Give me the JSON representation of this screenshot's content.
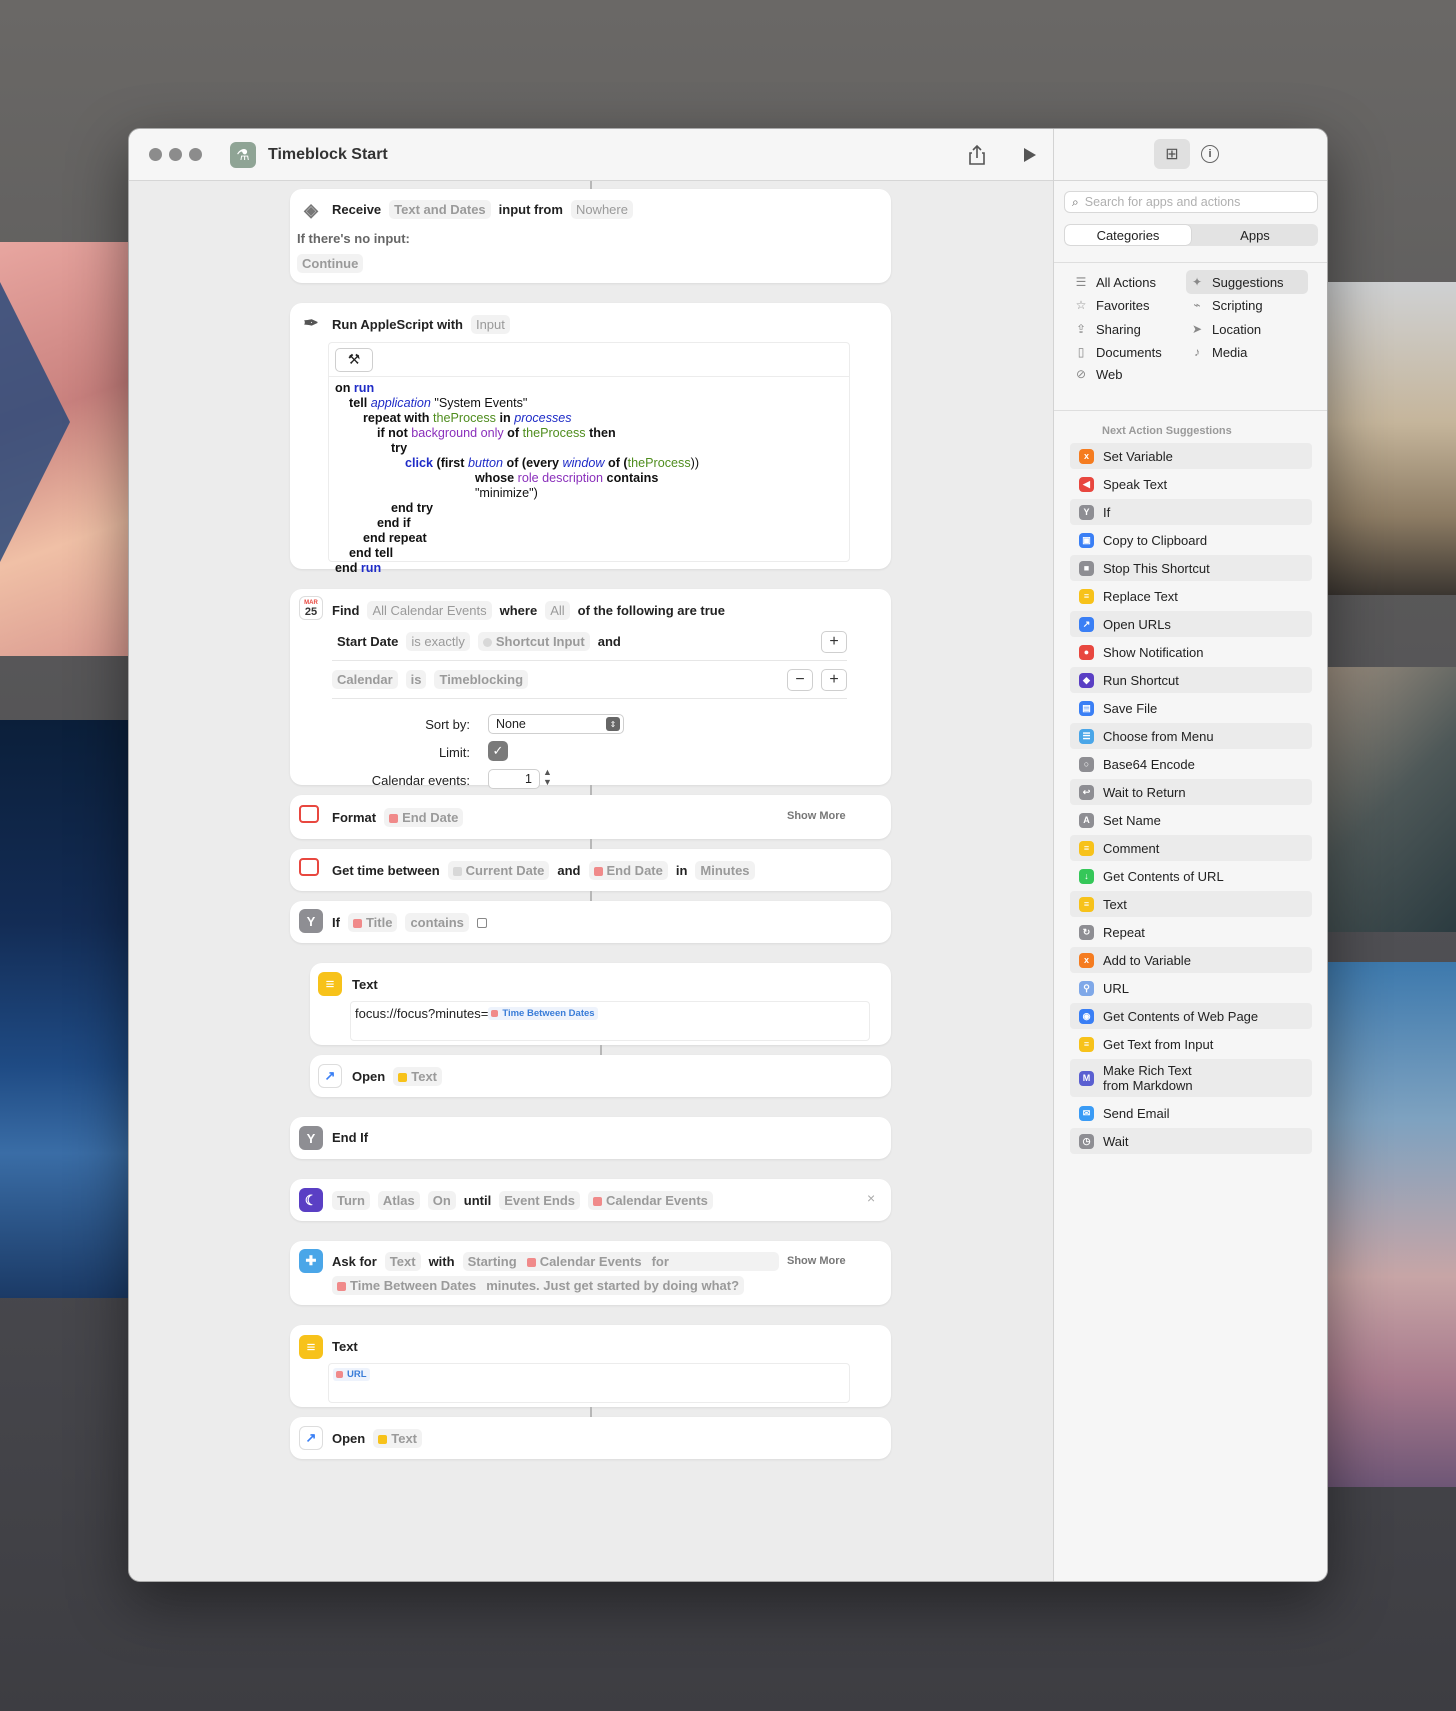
{
  "window": {
    "title": "Timeblock Start"
  },
  "actions": {
    "receive": {
      "verb": "Receive",
      "types": "Text and Dates",
      "mid": "input from",
      "source": "Nowhere",
      "noinput_label": "If there's no input:",
      "noinput_value": "Continue"
    },
    "applescript": {
      "title": "Run AppleScript with",
      "input": "Input",
      "lines": [
        [
          [
            "on ",
            "b"
          ],
          [
            "run",
            "b blue"
          ]
        ],
        [
          [
            "    tell ",
            "b"
          ],
          [
            "application",
            "it blue"
          ],
          [
            " \"System Events\"",
            ""
          ]
        ],
        [
          [
            "        repeat with ",
            "b"
          ],
          [
            "theProcess",
            "grn"
          ],
          [
            " in ",
            "b"
          ],
          [
            "processes",
            "it blue"
          ]
        ],
        [
          [
            "            if not ",
            "b"
          ],
          [
            "background only",
            "pur"
          ],
          [
            " of ",
            "b"
          ],
          [
            "theProcess",
            "grn"
          ],
          [
            " then",
            "b"
          ]
        ],
        [
          [
            "                try",
            "b"
          ]
        ],
        [
          [
            "                    ",
            "b"
          ],
          [
            "click",
            "b blue"
          ],
          [
            " (",
            "b"
          ],
          [
            "first ",
            "b"
          ],
          [
            "button",
            "it blue"
          ],
          [
            " of (",
            "b"
          ],
          [
            "every ",
            "b"
          ],
          [
            "window",
            "it blue"
          ],
          [
            " of (",
            "b"
          ],
          [
            "theProcess",
            "grn"
          ],
          [
            "))",
            ""
          ]
        ],
        [
          [
            "                                        whose ",
            "b"
          ],
          [
            "role description",
            "pur"
          ],
          [
            " contains",
            "b"
          ]
        ],
        [
          [
            "                                        \"minimize\")",
            ""
          ]
        ],
        [
          [
            "                end try",
            "b"
          ]
        ],
        [
          [
            "            end if",
            "b"
          ]
        ],
        [
          [
            "        end repeat",
            "b"
          ]
        ],
        [
          [
            "    end tell",
            "b"
          ]
        ],
        [
          [
            "end ",
            "b"
          ],
          [
            "run",
            "b blue"
          ]
        ]
      ]
    },
    "find": {
      "verb": "Find",
      "source": "All Calendar Events",
      "where": "where",
      "all": "All",
      "tail": "of the following are true",
      "filter1": {
        "field": "Start Date",
        "op": "is exactly",
        "value": "Shortcut Input",
        "conj": "and"
      },
      "filter2": {
        "field": "Calendar",
        "op": "is",
        "value": "Timeblocking"
      },
      "sort_label": "Sort by:",
      "sort_value": "None",
      "limit_label": "Limit:",
      "limit_checked": true,
      "events_label": "Calendar events:",
      "events_value": "1",
      "date_badge_top": "MAR",
      "date_badge_num": "25"
    },
    "format": {
      "verb": "Format",
      "value": "End Date",
      "show_more": "Show More"
    },
    "timebetween": {
      "verb": "Get time between",
      "a": "Current Date",
      "and": "and",
      "b": "End Date",
      "in": "in",
      "unit": "Minutes"
    },
    "if": {
      "verb": "If",
      "field": "Title",
      "op": "contains"
    },
    "text1": {
      "title": "Text",
      "prefix": "focus://focus?minutes=",
      "var": "Time Between Dates"
    },
    "open1": {
      "verb": "Open",
      "value": "Text"
    },
    "endif": {
      "label": "End If"
    },
    "focus": {
      "a": "Turn",
      "b": "Atlas",
      "c": "On",
      "until": "until",
      "d": "Event Ends",
      "e": "Calendar Events"
    },
    "ask": {
      "verb": "Ask for",
      "type": "Text",
      "with": "with",
      "a": "Starting",
      "b": "Calendar Events",
      "for": "for",
      "show_more": "Show More",
      "c": "Time Between Dates",
      "d": "minutes. Just get started by doing what?"
    },
    "text2": {
      "title": "Text",
      "var": "URL"
    },
    "open2": {
      "verb": "Open",
      "value": "Text"
    }
  },
  "sidebar": {
    "search_placeholder": "Search for apps and actions",
    "seg": [
      "Categories",
      "Apps"
    ],
    "categories": [
      {
        "label": "All Actions",
        "icon": "list-icon"
      },
      {
        "label": "Suggestions",
        "icon": "sparkle-icon"
      },
      {
        "label": "Favorites",
        "icon": "star-icon"
      },
      {
        "label": "Scripting",
        "icon": "scripting-icon"
      },
      {
        "label": "Sharing",
        "icon": "share-icon"
      },
      {
        "label": "Location",
        "icon": "location-icon"
      },
      {
        "label": "Documents",
        "icon": "document-icon"
      },
      {
        "label": "Media",
        "icon": "music-icon"
      },
      {
        "label": "Web",
        "icon": "compass-icon"
      }
    ],
    "suggestions_heading": "Next Action Suggestions",
    "suggestions": [
      {
        "label": "Set Variable",
        "color": "#f57c20",
        "glyph": "x"
      },
      {
        "label": "Speak Text",
        "color": "#e8473f",
        "glyph": "◀"
      },
      {
        "label": "If",
        "color": "#8e8e93",
        "glyph": "Y"
      },
      {
        "label": "Copy to Clipboard",
        "color": "#3a7ff5",
        "glyph": "▣"
      },
      {
        "label": "Stop This Shortcut",
        "color": "#8e8e93",
        "glyph": "■"
      },
      {
        "label": "Replace Text",
        "color": "#f7c21a",
        "glyph": "≡"
      },
      {
        "label": "Open URLs",
        "color": "#3a7ff5",
        "glyph": "↗"
      },
      {
        "label": "Show Notification",
        "color": "#e8473f",
        "glyph": "●"
      },
      {
        "label": "Run Shortcut",
        "color": "#5a3fc4",
        "glyph": "◆"
      },
      {
        "label": "Save File",
        "color": "#3a7ff5",
        "glyph": "▤"
      },
      {
        "label": "Choose from Menu",
        "color": "#4aa6e8",
        "glyph": "☰"
      },
      {
        "label": "Base64 Encode",
        "color": "#8e8e93",
        "glyph": "○"
      },
      {
        "label": "Wait to Return",
        "color": "#8e8e93",
        "glyph": "↩"
      },
      {
        "label": "Set Name",
        "color": "#8e8e93",
        "glyph": "A"
      },
      {
        "label": "Comment",
        "color": "#f7c21a",
        "glyph": "≡"
      },
      {
        "label": "Get Contents of URL",
        "color": "#35c759",
        "glyph": "↓"
      },
      {
        "label": "Text",
        "color": "#f7c21a",
        "glyph": "≡"
      },
      {
        "label": "Repeat",
        "color": "#8e8e93",
        "glyph": "↻"
      },
      {
        "label": "Add to Variable",
        "color": "#f57c20",
        "glyph": "x"
      },
      {
        "label": "URL",
        "color": "#7fa8e8",
        "glyph": "⚲"
      },
      {
        "label": "Get Contents of Web Page",
        "color": "#3a7ff5",
        "glyph": "◉"
      },
      {
        "label": "Get Text from Input",
        "color": "#f7c21a",
        "glyph": "≡"
      },
      {
        "label": "Make Rich Text from Markdown",
        "color": "#5a5fd1",
        "glyph": "M"
      },
      {
        "label": "Send Email",
        "color": "#3a9bf5",
        "glyph": "✉"
      },
      {
        "label": "Wait",
        "color": "#8e8e93",
        "glyph": "◷"
      }
    ]
  }
}
